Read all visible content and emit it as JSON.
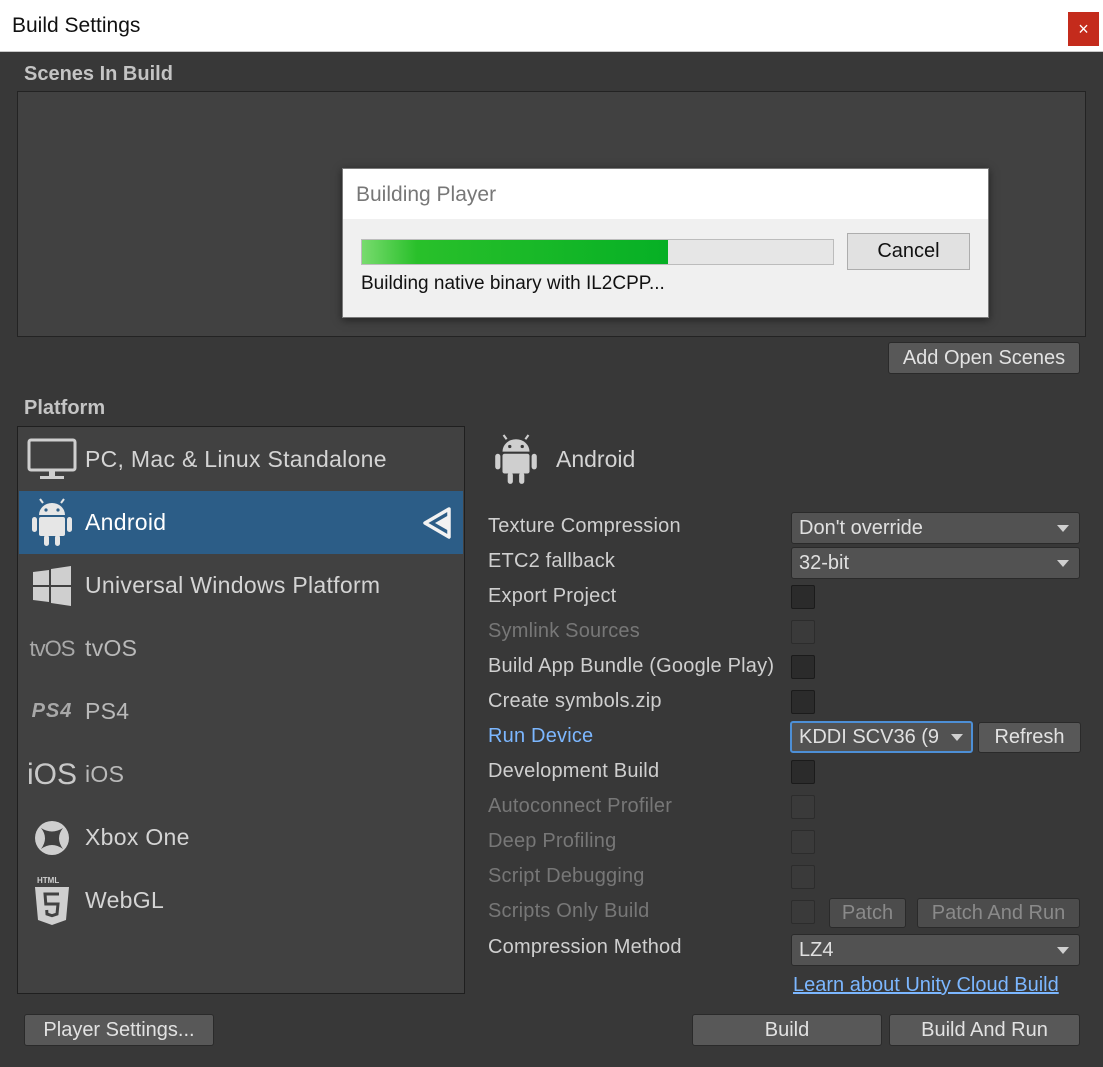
{
  "window": {
    "title": "Build Settings",
    "close_glyph": "×"
  },
  "scenes": {
    "label": "Scenes In Build",
    "add_open_scenes": "Add Open Scenes"
  },
  "platform": {
    "label": "Platform",
    "items": [
      {
        "name": "PC, Mac & Linux Standalone",
        "icon": "monitor-icon"
      },
      {
        "name": "Android",
        "icon": "android-icon",
        "selected": true
      },
      {
        "name": "Universal Windows Platform",
        "icon": "windows-icon"
      },
      {
        "name": "tvOS",
        "icon": "tvos-icon",
        "icon_text": "tvOS"
      },
      {
        "name": "PS4",
        "icon": "ps4-icon",
        "icon_text": "PS4"
      },
      {
        "name": "iOS",
        "icon": "ios-icon",
        "icon_text": "iOS"
      },
      {
        "name": "Xbox One",
        "icon": "xbox-icon"
      },
      {
        "name": "WebGL",
        "icon": "html5-icon",
        "icon_text": "HTML"
      }
    ]
  },
  "settings": {
    "header": "Android",
    "texture_compression": {
      "label": "Texture Compression",
      "value": "Don't override"
    },
    "etc2_fallback": {
      "label": "ETC2 fallback",
      "value": "32-bit"
    },
    "export_project": {
      "label": "Export Project"
    },
    "symlink_sources": {
      "label": "Symlink Sources"
    },
    "build_app_bundle": {
      "label": "Build App Bundle (Google Play)"
    },
    "create_symbols": {
      "label": "Create symbols.zip"
    },
    "run_device": {
      "label": "Run Device",
      "value": "KDDI SCV36 (9",
      "refresh": "Refresh"
    },
    "development_build": {
      "label": "Development Build"
    },
    "autoconnect_profiler": {
      "label": "Autoconnect Profiler"
    },
    "deep_profiling": {
      "label": "Deep Profiling"
    },
    "script_debugging": {
      "label": "Script Debugging"
    },
    "scripts_only_build": {
      "label": "Scripts Only Build",
      "patch": "Patch",
      "patch_and_run": "Patch And Run"
    },
    "compression_method": {
      "label": "Compression Method",
      "value": "LZ4"
    },
    "cloud_build_link": "Learn about Unity Cloud Build"
  },
  "footer": {
    "player_settings": "Player Settings...",
    "build": "Build",
    "build_and_run": "Build And Run"
  },
  "progress_dialog": {
    "title": "Building Player",
    "status": "Building native binary with IL2CPP...",
    "cancel": "Cancel",
    "progress": 0.65
  },
  "colors": {
    "accent": "#7cb7ff",
    "selected_bg": "#2c5d87",
    "progress": "#06b025",
    "close": "#c42b1c"
  }
}
